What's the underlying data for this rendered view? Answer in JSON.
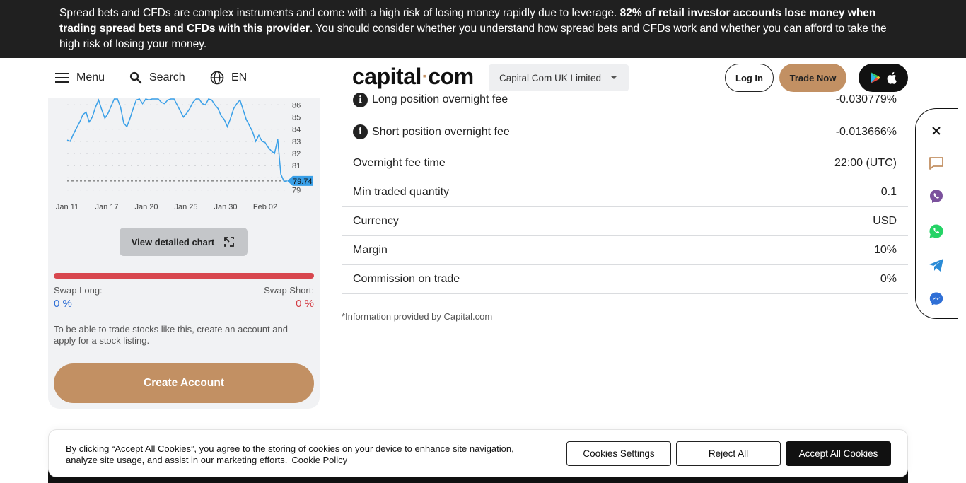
{
  "risk_banner": {
    "text_before": "Spread bets and CFDs are complex instruments and come with a high risk of losing money rapidly due to leverage. ",
    "text_bold": "82% of retail investor accounts lose money when trading spread bets and CFDs with this provider",
    "text_after": ". You should consider whether you understand how spread bets and CFDs work and whether you can afford to take the high risk of losing your money."
  },
  "header": {
    "menu_label": "Menu",
    "search_label": "Search",
    "lang_label": "EN",
    "logo_left": "capital",
    "logo_dot": "·",
    "logo_right": "com",
    "entity_selected": "Capital Com UK Limited",
    "login_label": "Log In",
    "trade_label": "Trade Now",
    "icons": [
      "menu-icon",
      "search-icon",
      "globe-icon",
      "google-play-icon",
      "apple-icon",
      "chevron-down-icon"
    ]
  },
  "chart_data": {
    "type": "line",
    "x_ticks": [
      "Jan 11",
      "Jan 17",
      "Jan 20",
      "Jan 25",
      "Jan 30",
      "Feb 02"
    ],
    "y_ticks": [
      "86",
      "85",
      "84",
      "83",
      "82",
      "81",
      "80",
      "79"
    ],
    "current_price_label": "79.74",
    "current_price": 79.74,
    "ylim": [
      78.8,
      86.6
    ],
    "line_color": "#3aa0e8",
    "series": [
      {
        "values": [
          83.1,
          83.0,
          83.6,
          84.1,
          84.6,
          85.2,
          85.4,
          84.6,
          85.0,
          85.8,
          86.4,
          85.6,
          84.9,
          85.3,
          85.9,
          86.6,
          86.5,
          85.8,
          84.5,
          84.2,
          84.9,
          85.7,
          86.4,
          86.5,
          86.1,
          86.7,
          86.4,
          86.5,
          86.8,
          86.6,
          86.2,
          86.1,
          86.4,
          86.7,
          86.5,
          86.0,
          85.5,
          85.0,
          85.3,
          85.7,
          86.2,
          86.8,
          86.5,
          86.1,
          86.0,
          86.6,
          86.4,
          86.0,
          85.7,
          85.1,
          84.8,
          84.2,
          84.9,
          85.7,
          86.1,
          86.4,
          85.6,
          84.8,
          84.3,
          83.8,
          83.0,
          83.5,
          83.0,
          82.9,
          82.5,
          82.2,
          82.0,
          83.2,
          80.3,
          79.7,
          79.74
        ]
      }
    ]
  },
  "left_card": {
    "view_chart_label": "View detailed chart",
    "swap_long_label": "Swap Long:",
    "swap_short_label": "Swap Short:",
    "swap_long_value": "0 %",
    "swap_short_value": "0 %",
    "note": "To be able to trade stocks like this, create an account and apply for a stock listing.",
    "create_label": "Create Account"
  },
  "details_table": {
    "rows": [
      {
        "label": "Long position overnight fee",
        "value": "-0.030779%",
        "info": true
      },
      {
        "label": "Short position overnight fee",
        "value": "-0.013666%",
        "info": true
      },
      {
        "label": "Overnight fee time",
        "value": "22:00 (UTC)",
        "info": false
      },
      {
        "label": "Min traded quantity",
        "value": "0.1",
        "info": false
      },
      {
        "label": "Currency",
        "value": "USD",
        "info": false
      },
      {
        "label": "Margin",
        "value": "10%",
        "info": false
      },
      {
        "label": "Commission on trade",
        "value": "0%",
        "info": false
      }
    ],
    "disclaimer": "*Information provided by Capital.com"
  },
  "social_bar": {
    "icons": [
      "close-icon",
      "chat-icon",
      "viber-icon",
      "whatsapp-icon",
      "telegram-icon",
      "messenger-icon"
    ],
    "colors": {
      "viber": "#7b519d",
      "whatsapp": "#25d366",
      "telegram": "#2a8bd6",
      "messenger": "#2f6fd6",
      "chat": "#c29063"
    }
  },
  "cookie_banner": {
    "text": "By clicking “Accept All Cookies”, you agree to the storing of cookies on your device to enhance site navigation, analyze site usage, and assist in our marketing efforts.",
    "policy_link": "Cookie Policy",
    "settings_label": "Cookies Settings",
    "reject_label": "Reject All",
    "accept_label": "Accept All Cookies"
  },
  "colors": {
    "brand": "#c29063",
    "banner_bg": "#202020",
    "swap_negative": "#d8474e",
    "swap_long": "#2f6fd6"
  }
}
